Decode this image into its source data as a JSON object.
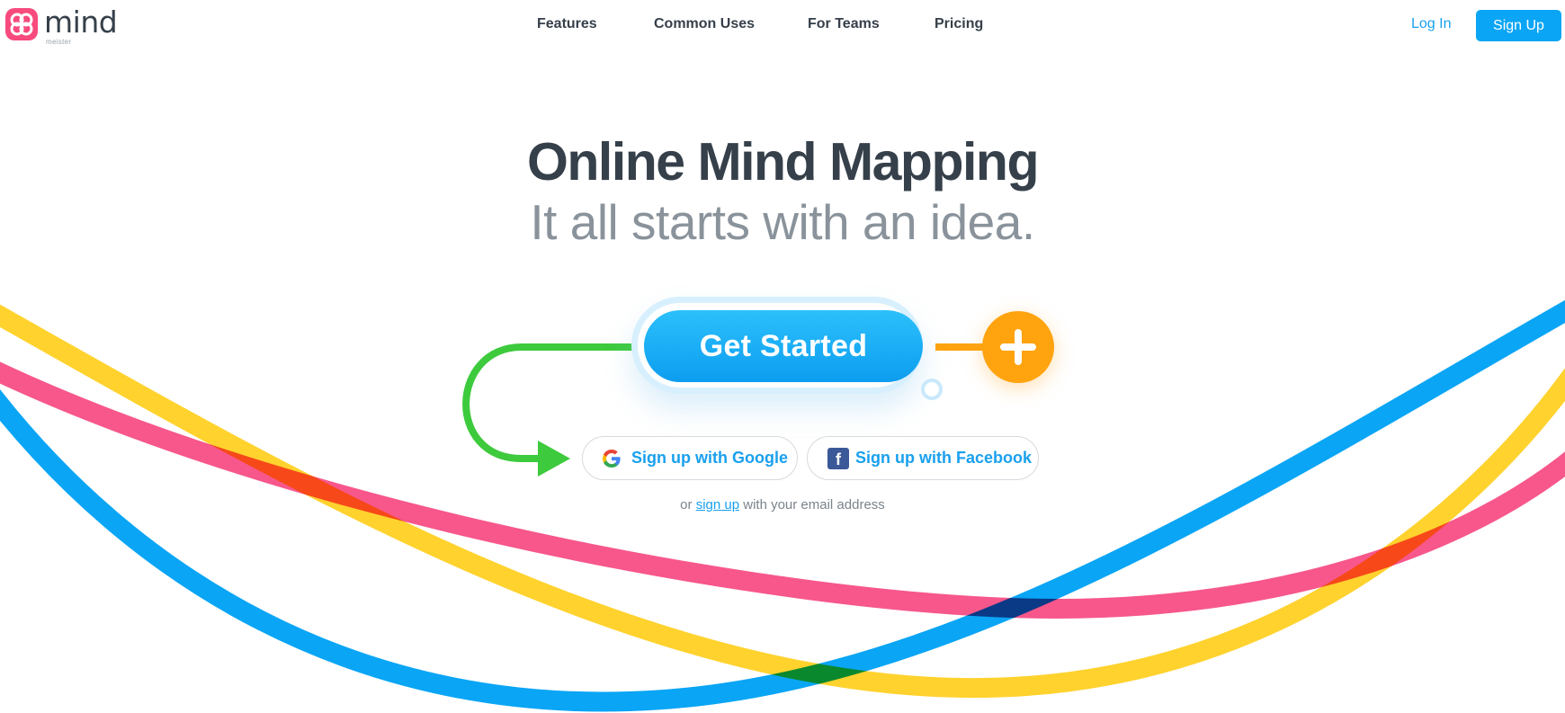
{
  "brand": {
    "name": "mind",
    "sub": "meister",
    "logo_icon": "mindmeister-logo-icon",
    "color": "#f74a7d"
  },
  "nav": {
    "items": [
      {
        "label": "Features"
      },
      {
        "label": "Common Uses"
      },
      {
        "label": "For Teams"
      },
      {
        "label": "Pricing"
      }
    ],
    "login_label": "Log In",
    "signup_label": "Sign Up"
  },
  "hero": {
    "title": "Online Mind Mapping",
    "subtitle": "It all starts with an idea."
  },
  "cta": {
    "label": "Get Started",
    "plus_icon": "plus-icon",
    "color": "#0d9df0",
    "plus_color": "#ffa30f"
  },
  "social": {
    "google_label": "Sign up with Google",
    "google_icon": "google-icon",
    "facebook_label": "Sign up with Facebook",
    "facebook_icon": "facebook-icon",
    "facebook_glyph": "f"
  },
  "email_signup": {
    "prefix": "or",
    "link": "sign up",
    "suffix": "with your email address"
  },
  "colors": {
    "accent": "#0aa5f5",
    "yellow": "#ffd22e",
    "pink": "#f7578b",
    "blue": "#0aa5f5",
    "green": "#3dca3d",
    "text": "#36404a",
    "muted": "#8a939b"
  }
}
